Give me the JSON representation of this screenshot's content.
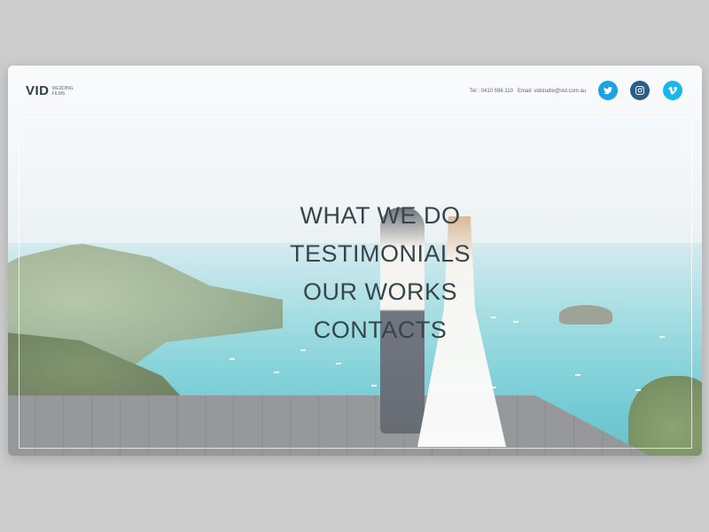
{
  "header": {
    "logo_text": "VID",
    "logo_subtitle": "WEDDING FILMS",
    "phone": "Tel : 0410 596 110",
    "email": "Email: vidstudio@vid.com.au"
  },
  "social": [
    {
      "icon": "twitter-icon",
      "color": "#1da1e2"
    },
    {
      "icon": "instagram-icon",
      "color": "#2c5d87"
    },
    {
      "icon": "vimeo-icon",
      "color": "#1ab7ea"
    }
  ],
  "menu": {
    "items": [
      {
        "label": "WHAT WE DO"
      },
      {
        "label": "TESTIMONIALS"
      },
      {
        "label": "OUR WORKS"
      },
      {
        "label": "CONTACTS"
      }
    ]
  },
  "colors": {
    "page_background": "#cccccc",
    "text_dark": "#35454b"
  }
}
